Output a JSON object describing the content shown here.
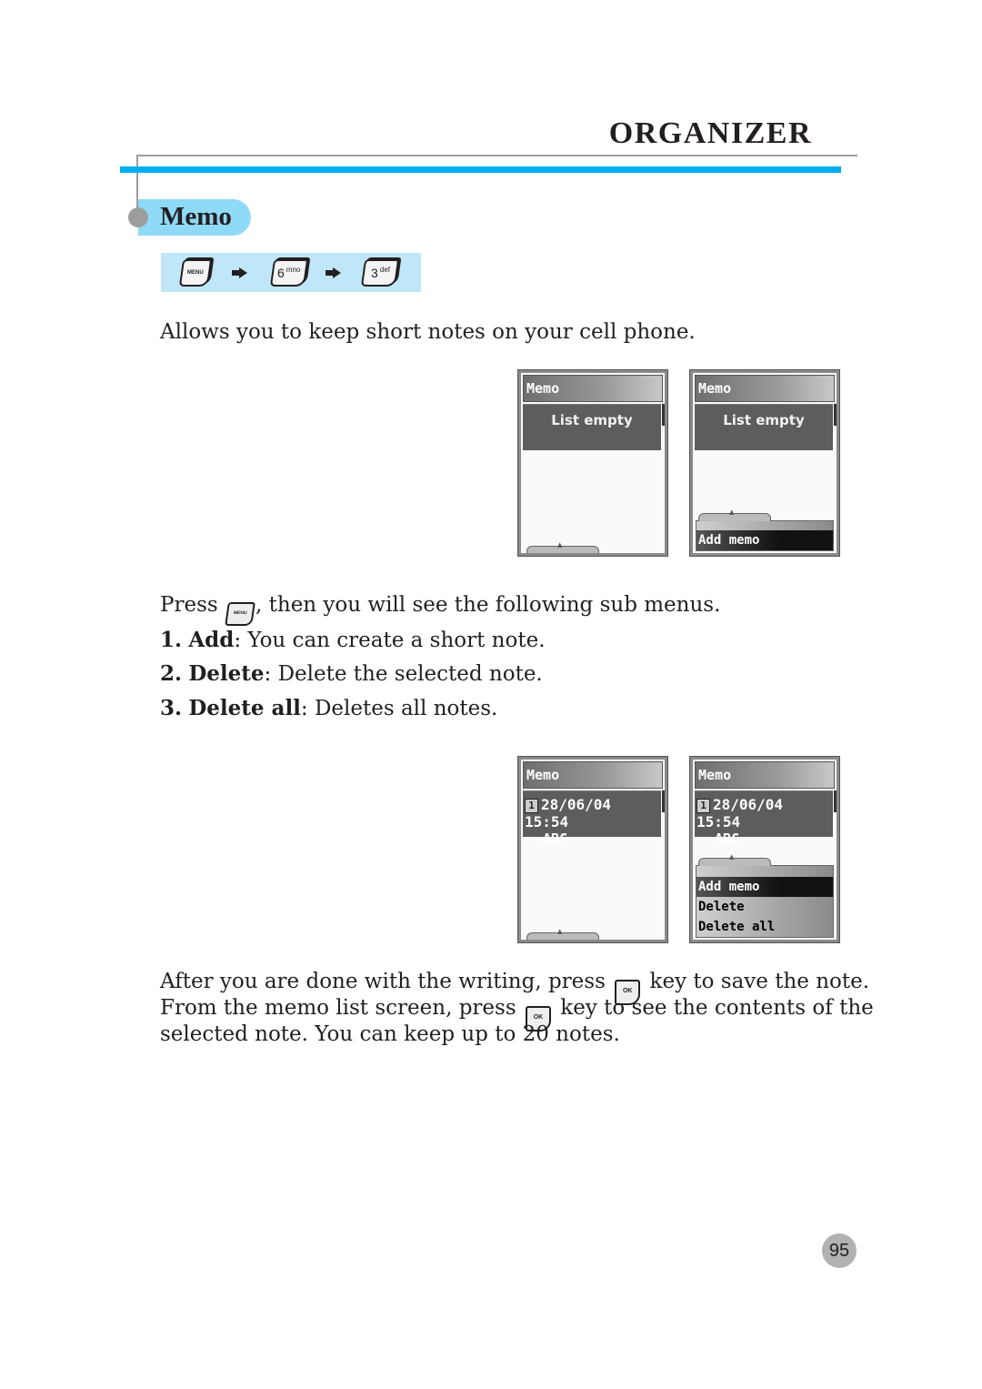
{
  "header": {
    "section_title": "ORGANIZER",
    "heading": "Memo",
    "accent_color": "#00aeef",
    "heading_bg_color": "#8fdaf7"
  },
  "key_path": {
    "keys": [
      {
        "icon": "menu-key-icon",
        "label": "MENU"
      },
      {
        "icon": "key-6-icon",
        "label": "6",
        "sub": "mno"
      },
      {
        "icon": "key-3-icon",
        "label": "3",
        "sub": "def"
      }
    ],
    "separator_icon": "arrow-right-icon"
  },
  "intro": "Allows you to keep short notes on your cell phone.",
  "screens_top": [
    {
      "title": "Memo",
      "status": "List empty",
      "menu": []
    },
    {
      "title": "Memo",
      "status": "List empty",
      "menu": [
        {
          "label": "Add memo",
          "selected": true
        }
      ]
    }
  ],
  "submenu_intro": {
    "before": "Press",
    "key": "MENU",
    "after": ", then you will see the following sub menus."
  },
  "submenus": [
    {
      "num": "1.",
      "name": "Add",
      "desc": ": You can create a short note."
    },
    {
      "num": "2.",
      "name": "Delete",
      "desc": ": Delete the selected note."
    },
    {
      "num": "3.",
      "name": "Delete all",
      "desc": ": Deletes all notes."
    }
  ],
  "screens_bottom": [
    {
      "title": "Memo",
      "entry_index": "1",
      "entry_datetime": "28/06/04 15:54",
      "entry_text": "ABC",
      "menu": []
    },
    {
      "title": "Memo",
      "entry_index": "1",
      "entry_datetime": "28/06/04 15:54",
      "entry_text": "ABC",
      "menu": [
        {
          "label": "Add memo",
          "selected": true
        },
        {
          "label": "Delete",
          "selected": false
        },
        {
          "label": "Delete all",
          "selected": false
        }
      ]
    }
  ],
  "closing": {
    "line1_before": "After you are done with the writing, press",
    "line1_after": "key to save the note.",
    "line2_before": "From the memo list screen, press",
    "line2_after": "key to see the contents of the",
    "line3": "selected note. You can keep up to 20 notes.",
    "ok_key_label": "OK"
  },
  "page_number": "95"
}
